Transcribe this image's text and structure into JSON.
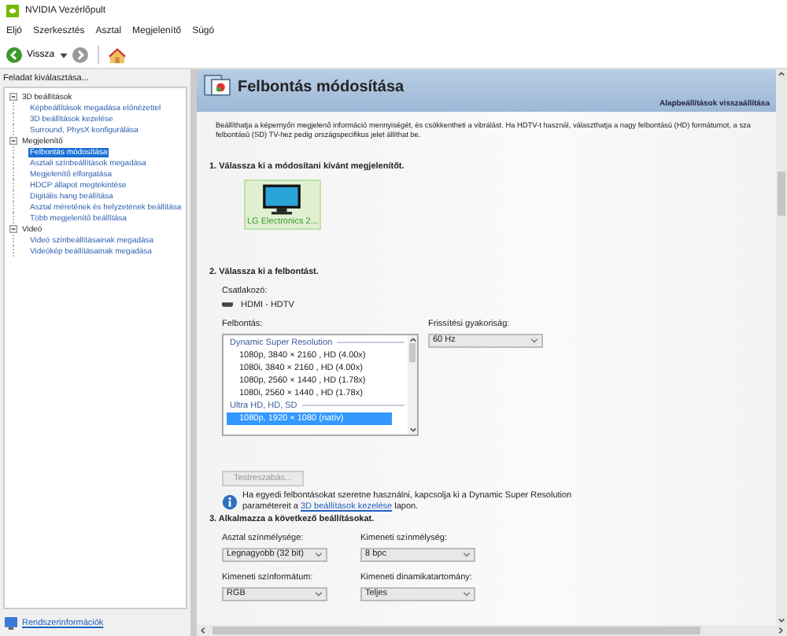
{
  "window": {
    "title": "NVIDIA Vezérlőpult"
  },
  "menu": [
    "Eljó",
    "Szerkesztés",
    "Asztal",
    "Megjelenítő",
    "Súgó"
  ],
  "toolbar": {
    "back_label": "Vissza"
  },
  "sidebar": {
    "title": "Feladat kiválasztása...",
    "tree": [
      {
        "label": "3D beállítások",
        "expanded": true,
        "selected": false,
        "children": [
          {
            "label": "Képbeállítások megadása előnézettel",
            "selected": false
          },
          {
            "label": "3D beállítások kezelése",
            "selected": false
          },
          {
            "label": "Surround, PhysX konfigurálása",
            "selected": false
          }
        ]
      },
      {
        "label": "Megjelenítő",
        "expanded": true,
        "selected": false,
        "children": [
          {
            "label": "Felbontás módosítása",
            "selected": true
          },
          {
            "label": "Asztali színbeállítások megadása",
            "selected": false
          },
          {
            "label": "Megjelenítő elforgatása",
            "selected": false
          },
          {
            "label": "HDCP állapot megtekintése",
            "selected": false
          },
          {
            "label": "Digitális hang beállítása",
            "selected": false
          },
          {
            "label": "Asztal méretének és helyzetének beállítása",
            "selected": false
          },
          {
            "label": "Több megjelenítő beállítása",
            "selected": false
          }
        ]
      },
      {
        "label": "Videó",
        "expanded": true,
        "selected": false,
        "children": [
          {
            "label": "Videó színbeállításainak megadása",
            "selected": false
          },
          {
            "label": "Videókép beállításainak megadása",
            "selected": false
          }
        ]
      }
    ],
    "footer_link": "Rendszerinformációk"
  },
  "page": {
    "title": "Felbontás módosítása",
    "restore_link": "Alapbeállítások visszaállítása",
    "description": "Beállíthatja a képernyőn megjelenő információ mennyiségét, és csökkentheti a vibrálást. Ha HDTV-t használ, választhatja a nagy felbontású (HD) formátumot, a sza",
    "description_line2": "felbontású (SD) TV-hez pedig országspecifikus jelet állíthat be.",
    "step1": {
      "heading": "1. Válassza ki a módosítani kívánt megjelenítőt.",
      "displays": [
        {
          "label": "LG Electronics 2...",
          "selected": true
        }
      ]
    },
    "step2": {
      "heading": "2. Válassza ki a felbontást.",
      "connector_label": "Csatlakozó:",
      "connector_value": "HDMI - HDTV",
      "resolution_label": "Felbontás:",
      "resolutions": [
        {
          "kind": "group",
          "label": "Dynamic Super Resolution"
        },
        {
          "kind": "item",
          "label": "1080p, 3840 × 2160 , HD (4.00x)",
          "selected": false
        },
        {
          "kind": "item",
          "label": "1080i, 3840 × 2160 , HD (4.00x)",
          "selected": false
        },
        {
          "kind": "item",
          "label": "1080p, 2560 × 1440 , HD (1.78x)",
          "selected": false
        },
        {
          "kind": "item",
          "label": "1080i, 2560 × 1440 , HD (1.78x)",
          "selected": false
        },
        {
          "kind": "group",
          "label": "Ultra HD, HD, SD"
        },
        {
          "kind": "item",
          "label": "1080p, 1920 × 1080 (natív)",
          "selected": true
        }
      ],
      "refresh_label": "Frissítési gyakoriság:",
      "refresh_value": "60 Hz",
      "customize_button": {
        "label": "Testreszabás...",
        "disabled": true
      },
      "info": "Ha egyedi felbontásokat szeretne használni, kapcsolja ki a Dynamic Super Resolution",
      "info_line2_before": "paramétereit a ",
      "info_link": "3D beállítások kezelése",
      "info_line2_after": " lapon."
    },
    "step3": {
      "heading": "3. Alkalmazza a következő beállításokat.",
      "fields": [
        {
          "label": "Asztal színmélysége:",
          "value": "Legnagyobb (32 bit)"
        },
        {
          "label": "Kimeneti színmélység:",
          "value": "8 bpc"
        },
        {
          "label": "Kimeneti színformátum:",
          "value": "RGB"
        },
        {
          "label": "Kimeneti dinamikatartomány:",
          "value": "Teljes"
        }
      ]
    }
  }
}
